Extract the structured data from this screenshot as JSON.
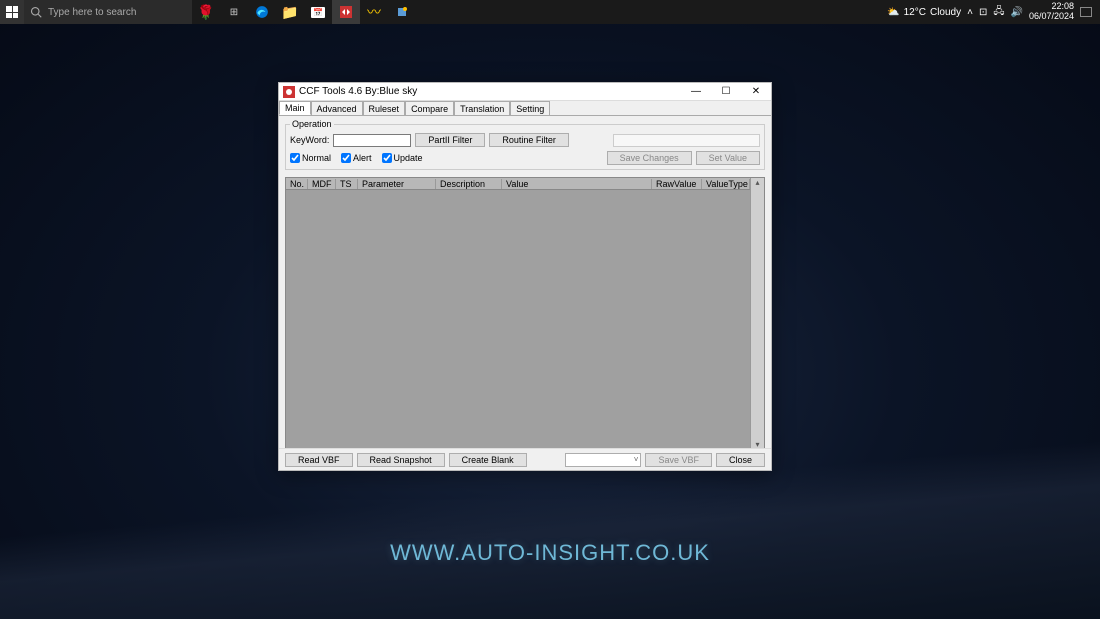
{
  "taskbar": {
    "search_placeholder": "Type here to search",
    "weather_temp": "12°C",
    "weather_cond": "Cloudy",
    "time": "22:08",
    "date": "06/07/2024"
  },
  "window": {
    "title": "CCF Tools 4.6   By:Blue sky",
    "tabs": [
      "Main",
      "Advanced",
      "Ruleset",
      "Compare",
      "Translation",
      "Setting"
    ],
    "active_tab": 0,
    "operation": {
      "legend": "Operation",
      "keyword_label": "KeyWord:",
      "keyword_value": "",
      "partii_btn": "PartII Filter",
      "routine_btn": "Routine Filter",
      "chk_normal": "Normal",
      "chk_alert": "Alert",
      "chk_update": "Update",
      "save_changes_btn": "Save Changes",
      "set_value_btn": "Set Value"
    },
    "grid": {
      "columns": [
        "No.",
        "MDF",
        "TS",
        "Parameter",
        "Description",
        "Value",
        "RawValue",
        "ValueType"
      ]
    },
    "bottom": {
      "read_vbf": "Read VBF",
      "read_snapshot": "Read Snapshot",
      "create_blank": "Create Blank",
      "save_vbf": "Save VBF",
      "close": "Close"
    }
  },
  "watermark": "WWW.AUTO-INSIGHT.CO.UK"
}
